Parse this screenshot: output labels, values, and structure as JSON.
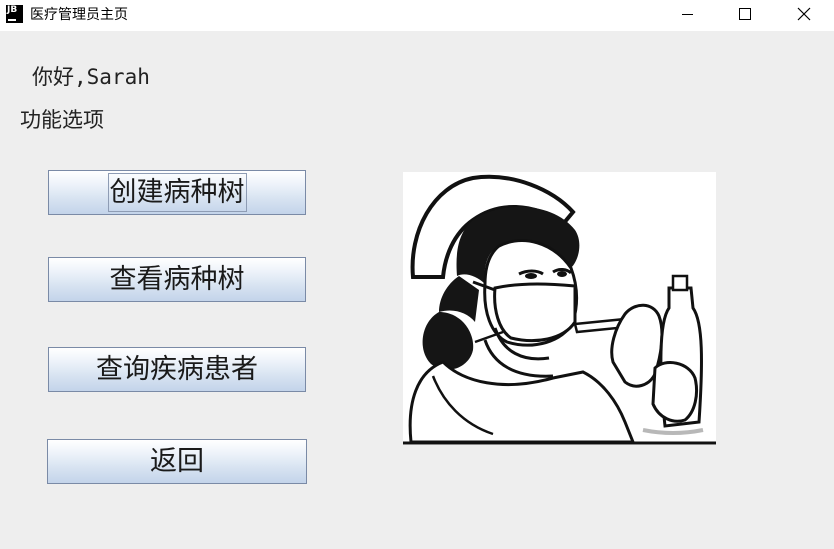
{
  "window": {
    "title": "医疗管理员主页",
    "icon_text": "JB",
    "icon": "jetbrains-app-icon",
    "controls": [
      "minimize-icon",
      "maximize-icon",
      "close-icon"
    ]
  },
  "greeting": "你好,Sarah",
  "section_label": "功能选项",
  "buttons": {
    "create_tree": "创建病种树",
    "view_tree": "查看病种树",
    "query_patients": "查询疾病患者",
    "back": "返回"
  },
  "illustration": {
    "icon": "nurse-with-syringe-image"
  },
  "colors": {
    "window_bg": "#eeeeee",
    "titlebar_bg": "#ffffff",
    "button_top": "#ffffff",
    "button_bottom": "#c3d4ea",
    "button_border": "#7a8aa6"
  }
}
